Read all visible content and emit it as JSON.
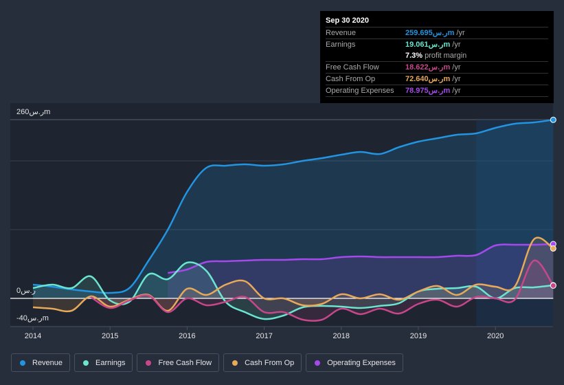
{
  "tooltip": {
    "date": "Sep 30 2020",
    "rows": [
      {
        "label": "Revenue",
        "value": "259.695ر.سm",
        "unit": " /yr",
        "color": "#2394df"
      },
      {
        "label": "Earnings",
        "value": "19.061ر.سm",
        "unit": " /yr",
        "color": "#6ce5d0"
      },
      {
        "label": "",
        "value": "7.3%",
        "unit": " profit margin",
        "color": "#ffffff"
      },
      {
        "label": "Free Cash Flow",
        "value": "18.622ر.سm",
        "unit": " /yr",
        "color": "#c8478a"
      },
      {
        "label": "Cash From Op",
        "value": "72.640ر.سm",
        "unit": " /yr",
        "color": "#e8a95a"
      },
      {
        "label": "Operating Expenses",
        "value": "78.975ر.سm",
        "unit": " /yr",
        "color": "#a649ec"
      }
    ]
  },
  "legend": [
    {
      "label": "Revenue",
      "color": "#2394df"
    },
    {
      "label": "Earnings",
      "color": "#6ce5d0"
    },
    {
      "label": "Free Cash Flow",
      "color": "#c8478a"
    },
    {
      "label": "Cash From Op",
      "color": "#e8a95a"
    },
    {
      "label": "Operating Expenses",
      "color": "#a649ec"
    }
  ],
  "chart_data": {
    "type": "line",
    "title": "",
    "xlabel": "",
    "ylabel": "",
    "y_unit": "ر.سm",
    "ylim": [
      -40,
      260
    ],
    "xlim": [
      2014,
      2020.75
    ],
    "y_tick_labels": [
      {
        "value": 260,
        "label": "260ر.سm"
      },
      {
        "value": 0,
        "label": "0ر.س"
      },
      {
        "value": -40,
        "label": "-40ر.سm"
      }
    ],
    "gridlines": [
      260,
      200,
      100
    ],
    "x_tick_labels": [
      "2014",
      "2015",
      "2016",
      "2017",
      "2018",
      "2019",
      "2020"
    ],
    "x_ticks": [
      2014,
      2015,
      2016,
      2017,
      2018,
      2019,
      2020
    ],
    "highlight_from": 2019.75,
    "legend_position": "bottom-left",
    "series": [
      {
        "name": "Revenue",
        "color": "#2394df",
        "x": [
          2014.0,
          2014.25,
          2014.5,
          2014.75,
          2015.0,
          2015.25,
          2015.5,
          2015.75,
          2016.0,
          2016.25,
          2016.5,
          2016.75,
          2017.0,
          2017.25,
          2017.5,
          2017.75,
          2018.0,
          2018.25,
          2018.5,
          2018.75,
          2019.0,
          2019.25,
          2019.5,
          2019.75,
          2020.0,
          2020.25,
          2020.5,
          2020.75
        ],
        "values": [
          20,
          17,
          13,
          10,
          8,
          15,
          55,
          100,
          155,
          190,
          193,
          195,
          193,
          195,
          200,
          204,
          209,
          213,
          210,
          220,
          228,
          233,
          238,
          240,
          248,
          254,
          256,
          259.7
        ]
      },
      {
        "name": "Operating Expenses",
        "color": "#a649ec",
        "x": [
          2015.75,
          2016.0,
          2016.25,
          2016.5,
          2016.75,
          2017.0,
          2017.25,
          2017.5,
          2017.75,
          2018.0,
          2018.25,
          2018.5,
          2018.75,
          2019.0,
          2019.25,
          2019.5,
          2019.75,
          2020.0,
          2020.25,
          2020.5,
          2020.75
        ],
        "values": [
          37,
          42,
          53,
          54,
          55,
          56,
          56,
          57,
          57,
          60,
          61,
          60,
          60,
          60,
          60,
          62,
          63,
          77,
          78,
          78,
          79.0
        ]
      },
      {
        "name": "Earnings",
        "color": "#6ce5d0",
        "x": [
          2014.0,
          2014.25,
          2014.5,
          2014.75,
          2015.0,
          2015.25,
          2015.5,
          2015.75,
          2016.0,
          2016.25,
          2016.5,
          2016.75,
          2017.0,
          2017.25,
          2017.5,
          2017.75,
          2018.0,
          2018.25,
          2018.5,
          2018.75,
          2019.0,
          2019.25,
          2019.5,
          2019.75,
          2020.0,
          2020.25,
          2020.5,
          2020.75
        ],
        "values": [
          15,
          20,
          15,
          32,
          -3,
          -5,
          35,
          28,
          52,
          40,
          -5,
          -20,
          -30,
          -25,
          -13,
          -11,
          -12,
          -14,
          -11,
          -7,
          10,
          14,
          15,
          17,
          0,
          15,
          16,
          19.1
        ]
      },
      {
        "name": "Cash From Op",
        "color": "#e8a95a",
        "x": [
          2014.0,
          2014.25,
          2014.5,
          2014.75,
          2015.0,
          2015.25,
          2015.5,
          2015.75,
          2016.0,
          2016.25,
          2016.5,
          2016.75,
          2017.0,
          2017.25,
          2017.5,
          2017.75,
          2018.0,
          2018.25,
          2018.5,
          2018.75,
          2019.0,
          2019.25,
          2019.5,
          2019.75,
          2020.0,
          2020.25,
          2020.5,
          2020.75
        ],
        "values": [
          -13,
          -15,
          -18,
          3,
          -12,
          -2,
          5,
          -18,
          14,
          5,
          20,
          25,
          0,
          0,
          -10,
          -8,
          6,
          0,
          6,
          -2,
          10,
          18,
          5,
          20,
          17,
          17,
          86,
          72.6
        ]
      },
      {
        "name": "Free Cash Flow",
        "color": "#c8478a",
        "x": [
          2014.75,
          2015.0,
          2015.25,
          2015.5,
          2015.75,
          2016.0,
          2016.25,
          2016.5,
          2016.75,
          2017.0,
          2017.25,
          2017.5,
          2017.75,
          2018.0,
          2018.25,
          2018.5,
          2018.75,
          2019.0,
          2019.25,
          2019.5,
          2019.75,
          2020.0,
          2020.25,
          2020.5,
          2020.75
        ],
        "values": [
          2,
          -14,
          -3,
          4,
          -20,
          0,
          -10,
          -5,
          2,
          -20,
          -20,
          -31,
          -31,
          -15,
          -23,
          -15,
          -22,
          -8,
          -2,
          -12,
          2,
          0,
          -2,
          55,
          18.6
        ]
      }
    ]
  }
}
